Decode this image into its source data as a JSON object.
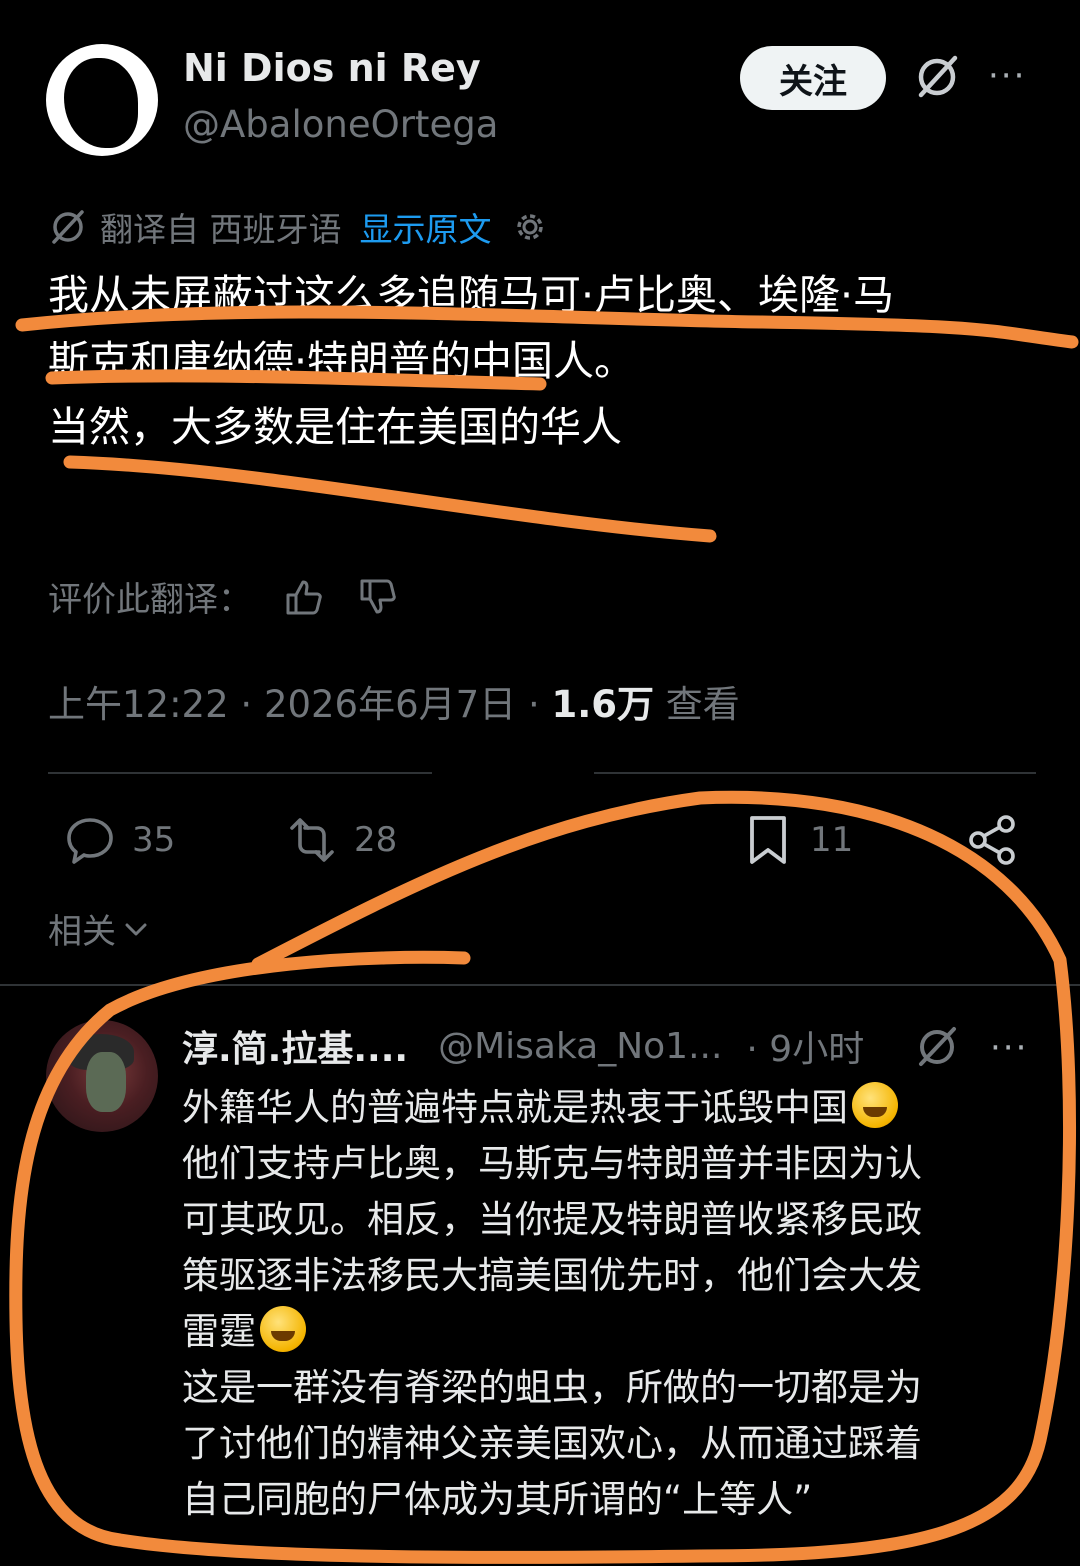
{
  "tweet": {
    "display_name": "Ni Dios ni Rey",
    "handle": "@AbaloneOrtega",
    "follow_label": "关注",
    "more": "···",
    "translated_from": "翻译自 西班牙语",
    "show_original": "显示原文",
    "text_lines": [
      "我从未屏蔽过这么多追随马可·卢比奥、埃隆·马",
      "斯克和唐纳德·特朗普的中国人。",
      "当然，大多数是住在美国的华人"
    ],
    "rate_translation_label": "评价此翻译：",
    "time": "上午12:22",
    "date": "2026年6月7日",
    "views_count": "1.6万",
    "views_label": "查看",
    "sep": "·"
  },
  "actions": {
    "replies": "35",
    "reposts": "28",
    "bookmarks": "11"
  },
  "related_label": "相关",
  "reply": {
    "display_name": "淳.简.拉基....",
    "handle": "@Misaka_No1...",
    "time": "· 9小时",
    "more": "···",
    "text_lines": [
      "外籍华人的普遍特点就是热衷于诋毁中国",
      "他们支持卢比奥，马斯克与特朗普并非因为认",
      "可其政见。相反，当你提及特朗普收紧移民政",
      "策驱逐非法移民大搞美国优先时，他们会大发",
      "雷霆",
      "这是一群没有脊梁的蛆虫，所做的一切都是为",
      "了讨他们的精神父亲美国欢心，从而通过踩着",
      "自己同胞的尸体成为其所谓的“上等人”"
    ]
  },
  "colors": {
    "background": "#000000",
    "link_blue": "#1d9bf0",
    "muted": "#71767b",
    "annotation_orange": "#f28a3c"
  },
  "icons": [
    "grok-icon",
    "more-icon",
    "gear-icon",
    "thumbs-up-icon",
    "thumbs-down-icon",
    "reply-icon",
    "repost-icon",
    "bookmark-icon",
    "share-icon",
    "chevron-down-icon",
    "emoji-icon"
  ]
}
